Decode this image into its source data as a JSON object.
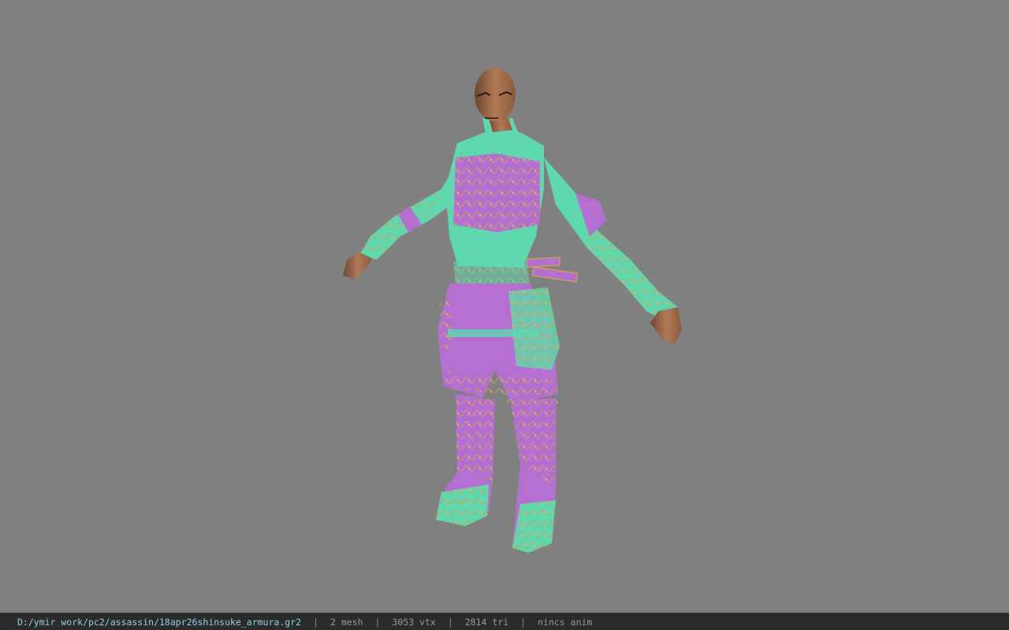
{
  "viewer": {
    "background_color": "#808080",
    "model_subject": "assassin character in purple and teal ornate armor, T-pose"
  },
  "status": {
    "path": "D:/ymir work/pc2/assassin/18apr26shinsuke_armura.gr2",
    "sep": "|",
    "mesh": "2 mesh",
    "vtx": "3053 vtx",
    "tri": "2814 tri",
    "anim": "nincs anim"
  },
  "colors": {
    "teal": "#5fd8b0",
    "purple": "#b46fd0",
    "gold": "#c9a25a",
    "skin": "#a06a45",
    "statusbar_bg": "#2b2b2b",
    "path_text": "#8fd3e6"
  }
}
